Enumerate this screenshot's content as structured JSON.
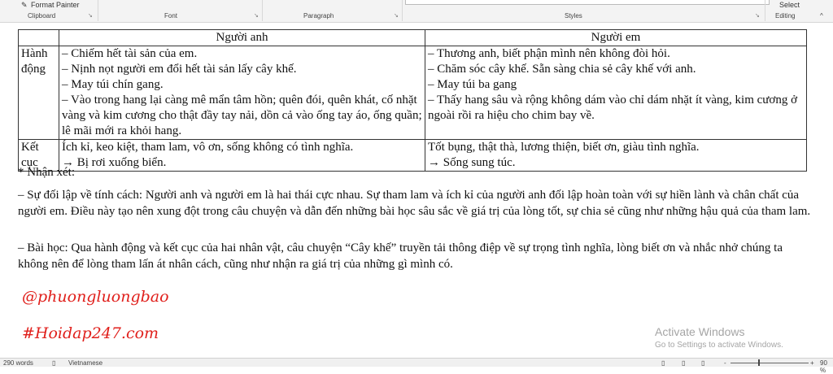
{
  "ribbon": {
    "format_painter": "Format Painter",
    "groups": [
      "Clipboard",
      "Font",
      "Paragraph",
      "Styles",
      "Editing"
    ],
    "select": "Select"
  },
  "table": {
    "headers": [
      "",
      "Người anh",
      "Người em"
    ],
    "rows": [
      {
        "label": "Hành động",
        "anh": [
          "– Chiếm hết tài sản của em.",
          "– Nịnh nọt người em đổi hết tài sản lấy cây khế.",
          "– May túi chín gang.",
          "– Vào trong hang lại càng mê mẩn tâm hồn; quên đói, quên khát, cố nhặt vàng và kim cương cho thật đầy tay nải, dồn cả vào ống tay áo, ống quần; lê mãi mới ra khỏi hang."
        ],
        "em": [
          "– Thương anh, biết phận mình nên không đòi hỏi.",
          "– Chăm sóc cây khế. Sẵn sàng chia sẻ cây khế với anh.",
          "– May túi ba gang",
          "– Thấy hang sâu và rộng không dám vào chỉ dám nhặt ít vàng, kim cương ở ngoài rồi ra hiệu cho chim bay về."
        ]
      },
      {
        "label": "Kết cục",
        "anh": [
          "Ích kỉ, keo kiệt, tham lam, vô ơn, sống không có tình nghĩa.",
          "→ Bị rơi xuống biển."
        ],
        "em": [
          "Tốt bụng, thật thà, lương thiện, biết ơn, giàu tình nghĩa.",
          "→ Sống sung túc."
        ]
      }
    ]
  },
  "remarks": {
    "heading": "* Nhận xét:",
    "p1": "– Sự đối lập về tính cách: Người anh và người em là hai thái cực nhau. Sự tham lam và ích kỉ của người anh đối lập hoàn toàn với sự hiền lành và chân chất của người em. Điều này tạo nên xung đột trong câu chuyện và dẫn đến những bài học sâu sắc về giá trị của lòng tốt, sự chia sẻ cũng như những hậu quả của tham lam.",
    "p2": "– Bài học: Qua hành động và kết cục của hai nhân vật, câu chuyện “Cây khế” truyền tải thông điệp về sự trọng tình nghĩa, lòng biết ơn và nhắc nhở chúng ta không nên để lòng tham lấn át nhân cách, cũng như nhận ra giá trị của những gì mình có."
  },
  "signature": {
    "line1": "@phuongluongbao",
    "line2": "#Hoidap247.com",
    "color": "#e0201c"
  },
  "activate": {
    "title": "Activate Windows",
    "subtitle": "Go to Settings to activate Windows."
  },
  "status": {
    "words": "290 words",
    "language": "Vietnamese",
    "zoom": "90 %"
  }
}
